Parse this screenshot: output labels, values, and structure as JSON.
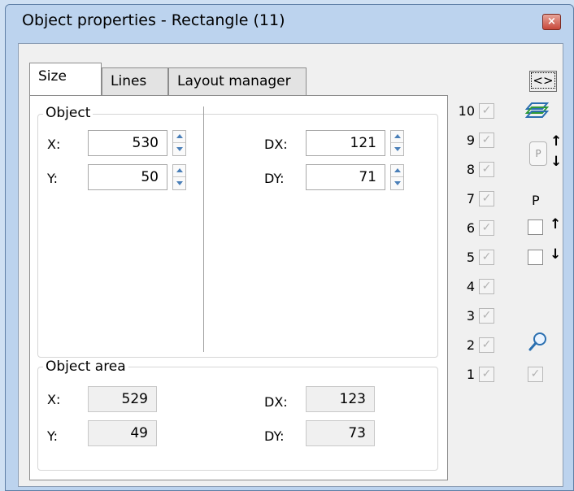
{
  "window": {
    "title": "Object properties - Rectangle (11)",
    "close_glyph": "×"
  },
  "tabs": [
    {
      "label": "Size",
      "active": true
    },
    {
      "label": "Lines",
      "active": false
    },
    {
      "label": "Layout manager",
      "active": false
    }
  ],
  "object_group": {
    "title": "Object",
    "x_label": "X:",
    "x_value": "530",
    "y_label": "Y:",
    "y_value": "50",
    "dx_label": "DX:",
    "dx_value": "121",
    "dy_label": "DY:",
    "dy_value": "71"
  },
  "area_group": {
    "title": "Object area",
    "x_label": "X:",
    "x_value": "529",
    "y_label": "Y:",
    "y_value": "49",
    "dx_label": "DX:",
    "dx_value": "123",
    "dy_label": "DY:",
    "dy_value": "73"
  },
  "side": {
    "code_button": "<>",
    "layers": [
      "10",
      "9",
      "8",
      "7",
      "6",
      "5",
      "4",
      "3",
      "2",
      "1"
    ],
    "check_glyph": "✓",
    "p_button": "P",
    "p_label": "P",
    "arrow_up": "↑",
    "arrow_down": "↓",
    "icons": [
      "layers-icon",
      "zoom-icon"
    ]
  }
}
